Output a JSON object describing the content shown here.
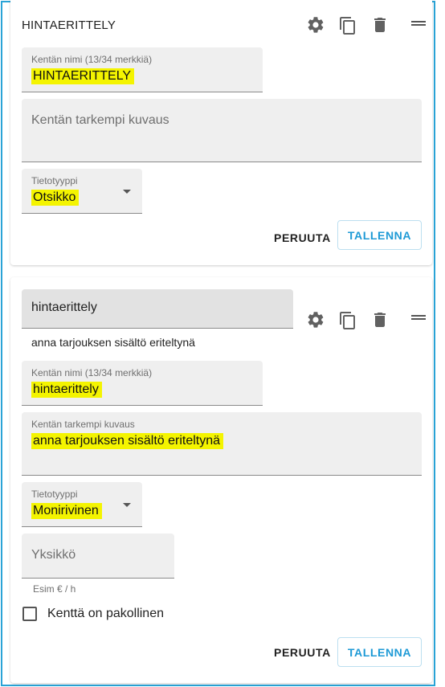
{
  "card1": {
    "title": "HINTAERITTELY",
    "name_field": {
      "label": "Kentän nimi (13/34 merkkiä)",
      "value": "HINTAERITTELY"
    },
    "description_field": {
      "placeholder": "Kentän tarkempi kuvaus"
    },
    "type_field": {
      "label": "Tietotyyppi",
      "value": "Otsikko"
    },
    "cancel_label": "PERUUTA",
    "save_label": "TALLENNA"
  },
  "card2": {
    "title": "hintaerittely",
    "subtitle": "anna tarjouksen sisältö eriteltynä",
    "name_field": {
      "label": "Kentän nimi (13/34 merkkiä)",
      "value": "hintaerittely"
    },
    "description_field": {
      "label": "Kentän tarkempi kuvaus",
      "value": "anna tarjouksen sisältö eriteltynä"
    },
    "type_field": {
      "label": "Tietotyyppi",
      "value": "Monirivinen"
    },
    "unit_field": {
      "placeholder": "Yksikkö",
      "helper": "Esim € / h"
    },
    "required_checkbox": {
      "label": "Kenttä on pakollinen",
      "checked": false
    },
    "cancel_label": "PERUUTA",
    "save_label": "TALLENNA"
  },
  "icons": [
    "gear-icon",
    "copy-icon",
    "trash-icon",
    "drag-handle-icon"
  ],
  "colors": {
    "accent": "#1e9ad6",
    "highlight": "#f4f400",
    "frame": "#2aa3d6"
  }
}
